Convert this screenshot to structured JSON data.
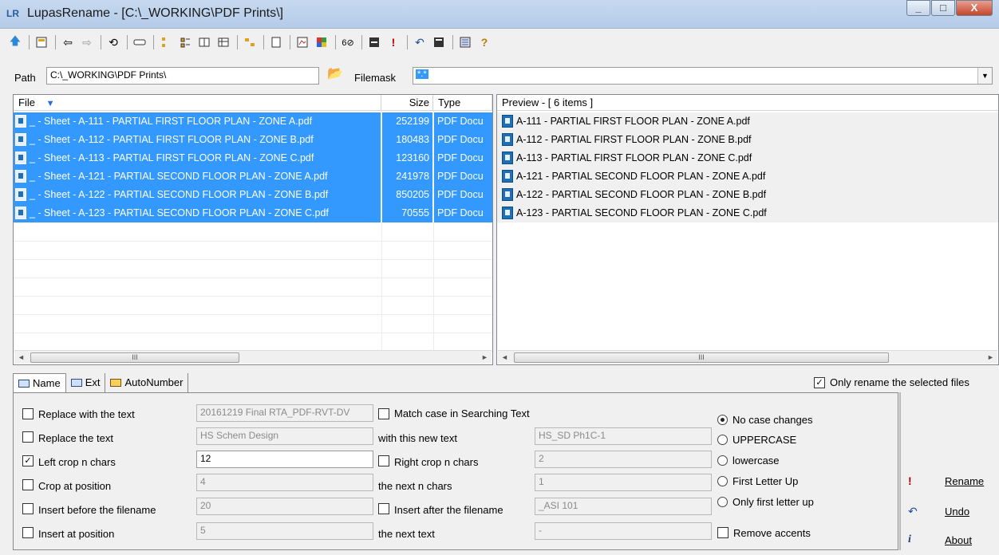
{
  "window": {
    "logo": "LR",
    "title": "LupasRename - [C:\\_WORKING\\PDF Prints\\]"
  },
  "toolbar": {
    "icons": [
      "up-arrow-icon",
      "panel-icon",
      "back-arrow-icon",
      "forward-arrow-icon",
      "refresh-icon",
      "drive-icon",
      "tree-icon",
      "details-icon",
      "list-icon",
      "grid-icon",
      "filter-icon",
      "page-icon",
      "preview-icon",
      "colors-icon",
      "compare-icon",
      "cmd-icon",
      "rename-icon",
      "undo-icon",
      "undo-bat-icon",
      "settings-icon",
      "help-icon"
    ]
  },
  "path": {
    "label": "Path",
    "value": "C:\\_WORKING\\PDF Prints\\",
    "filemask_label": "Filemask",
    "filemask_value": "*.*"
  },
  "file_list": {
    "headers": {
      "file": "File",
      "size": "Size",
      "type": "Type"
    },
    "rows": [
      {
        "name": "_ - Sheet - A-111 - PARTIAL FIRST FLOOR PLAN - ZONE A.pdf",
        "size": "252199",
        "type": "PDF Docu"
      },
      {
        "name": "_ - Sheet - A-112 - PARTIAL FIRST FLOOR PLAN - ZONE B.pdf",
        "size": "180483",
        "type": "PDF Docu"
      },
      {
        "name": "_ - Sheet - A-113 - PARTIAL FIRST FLOOR PLAN - ZONE C.pdf",
        "size": "123160",
        "type": "PDF Docu"
      },
      {
        "name": "_ - Sheet - A-121 - PARTIAL SECOND FLOOR PLAN - ZONE A.pdf",
        "size": "241978",
        "type": "PDF Docu"
      },
      {
        "name": "_ - Sheet - A-122 - PARTIAL SECOND FLOOR PLAN - ZONE B.pdf",
        "size": "850205",
        "type": "PDF Docu"
      },
      {
        "name": "_ - Sheet - A-123 - PARTIAL SECOND FLOOR PLAN - ZONE C.pdf",
        "size": "70555",
        "type": "PDF Docu"
      }
    ]
  },
  "preview": {
    "header": "Preview - [ 6 items ]",
    "rows": [
      "A-111 - PARTIAL FIRST FLOOR PLAN - ZONE A.pdf",
      "A-112 - PARTIAL FIRST FLOOR PLAN - ZONE B.pdf",
      "A-113 - PARTIAL FIRST FLOOR PLAN - ZONE C.pdf",
      "A-121 - PARTIAL SECOND FLOOR PLAN - ZONE A.pdf",
      "A-122 - PARTIAL SECOND FLOOR PLAN - ZONE B.pdf",
      "A-123 - PARTIAL SECOND FLOOR PLAN - ZONE C.pdf"
    ]
  },
  "scrollbar": {
    "left_arrow": "◄",
    "right_arrow": "►",
    "thumb": "III"
  },
  "tabs": [
    {
      "label": "Name"
    },
    {
      "label": "Ext"
    },
    {
      "label": "AutoNumber"
    }
  ],
  "only_selected": {
    "label": "Only rename the selected files",
    "checked": true
  },
  "options": {
    "replace_with_text": {
      "label": "Replace with the text",
      "checked": false,
      "value": "20161219 Final RTA_PDF-RVT-DV"
    },
    "match_case": {
      "label": "Match case  in Searching Text",
      "checked": false
    },
    "replace_the_text": {
      "label": "Replace the text",
      "checked": false,
      "value": "HS Schem Design"
    },
    "with_new_text": {
      "label": "with this new text",
      "value": "HS_SD Ph1C-1"
    },
    "left_crop": {
      "label": "Left crop n chars",
      "checked": true,
      "value": "12"
    },
    "right_crop": {
      "label": "Right crop n chars",
      "checked": false,
      "value": "2"
    },
    "crop_at_position": {
      "label": "Crop at position",
      "checked": false,
      "value": "4"
    },
    "next_n_chars": {
      "label": "the next n chars",
      "value": "1"
    },
    "insert_before": {
      "label": "Insert before the filename",
      "checked": false,
      "value": "20"
    },
    "insert_after": {
      "label": "Insert after the filename",
      "checked": false,
      "value": "_ASI 101"
    },
    "insert_at_position": {
      "label": "Insert at position",
      "checked": false,
      "value": "5"
    },
    "next_text": {
      "label": "the next text",
      "value": "-"
    }
  },
  "case": {
    "options": [
      "No case changes",
      "UPPERCASE",
      "lowercase",
      "First Letter Up",
      "Only first letter up"
    ],
    "selected": 0
  },
  "remove_accents": {
    "label": "Remove accents",
    "checked": false
  },
  "buttons": {
    "rename": "Rename",
    "undo": "Undo",
    "about": "About"
  },
  "icons": {
    "rename": "!",
    "undo": "↶",
    "about": "i",
    "check": "✓",
    "sort": "▼",
    "folder": "📂",
    "combo": "▼"
  }
}
